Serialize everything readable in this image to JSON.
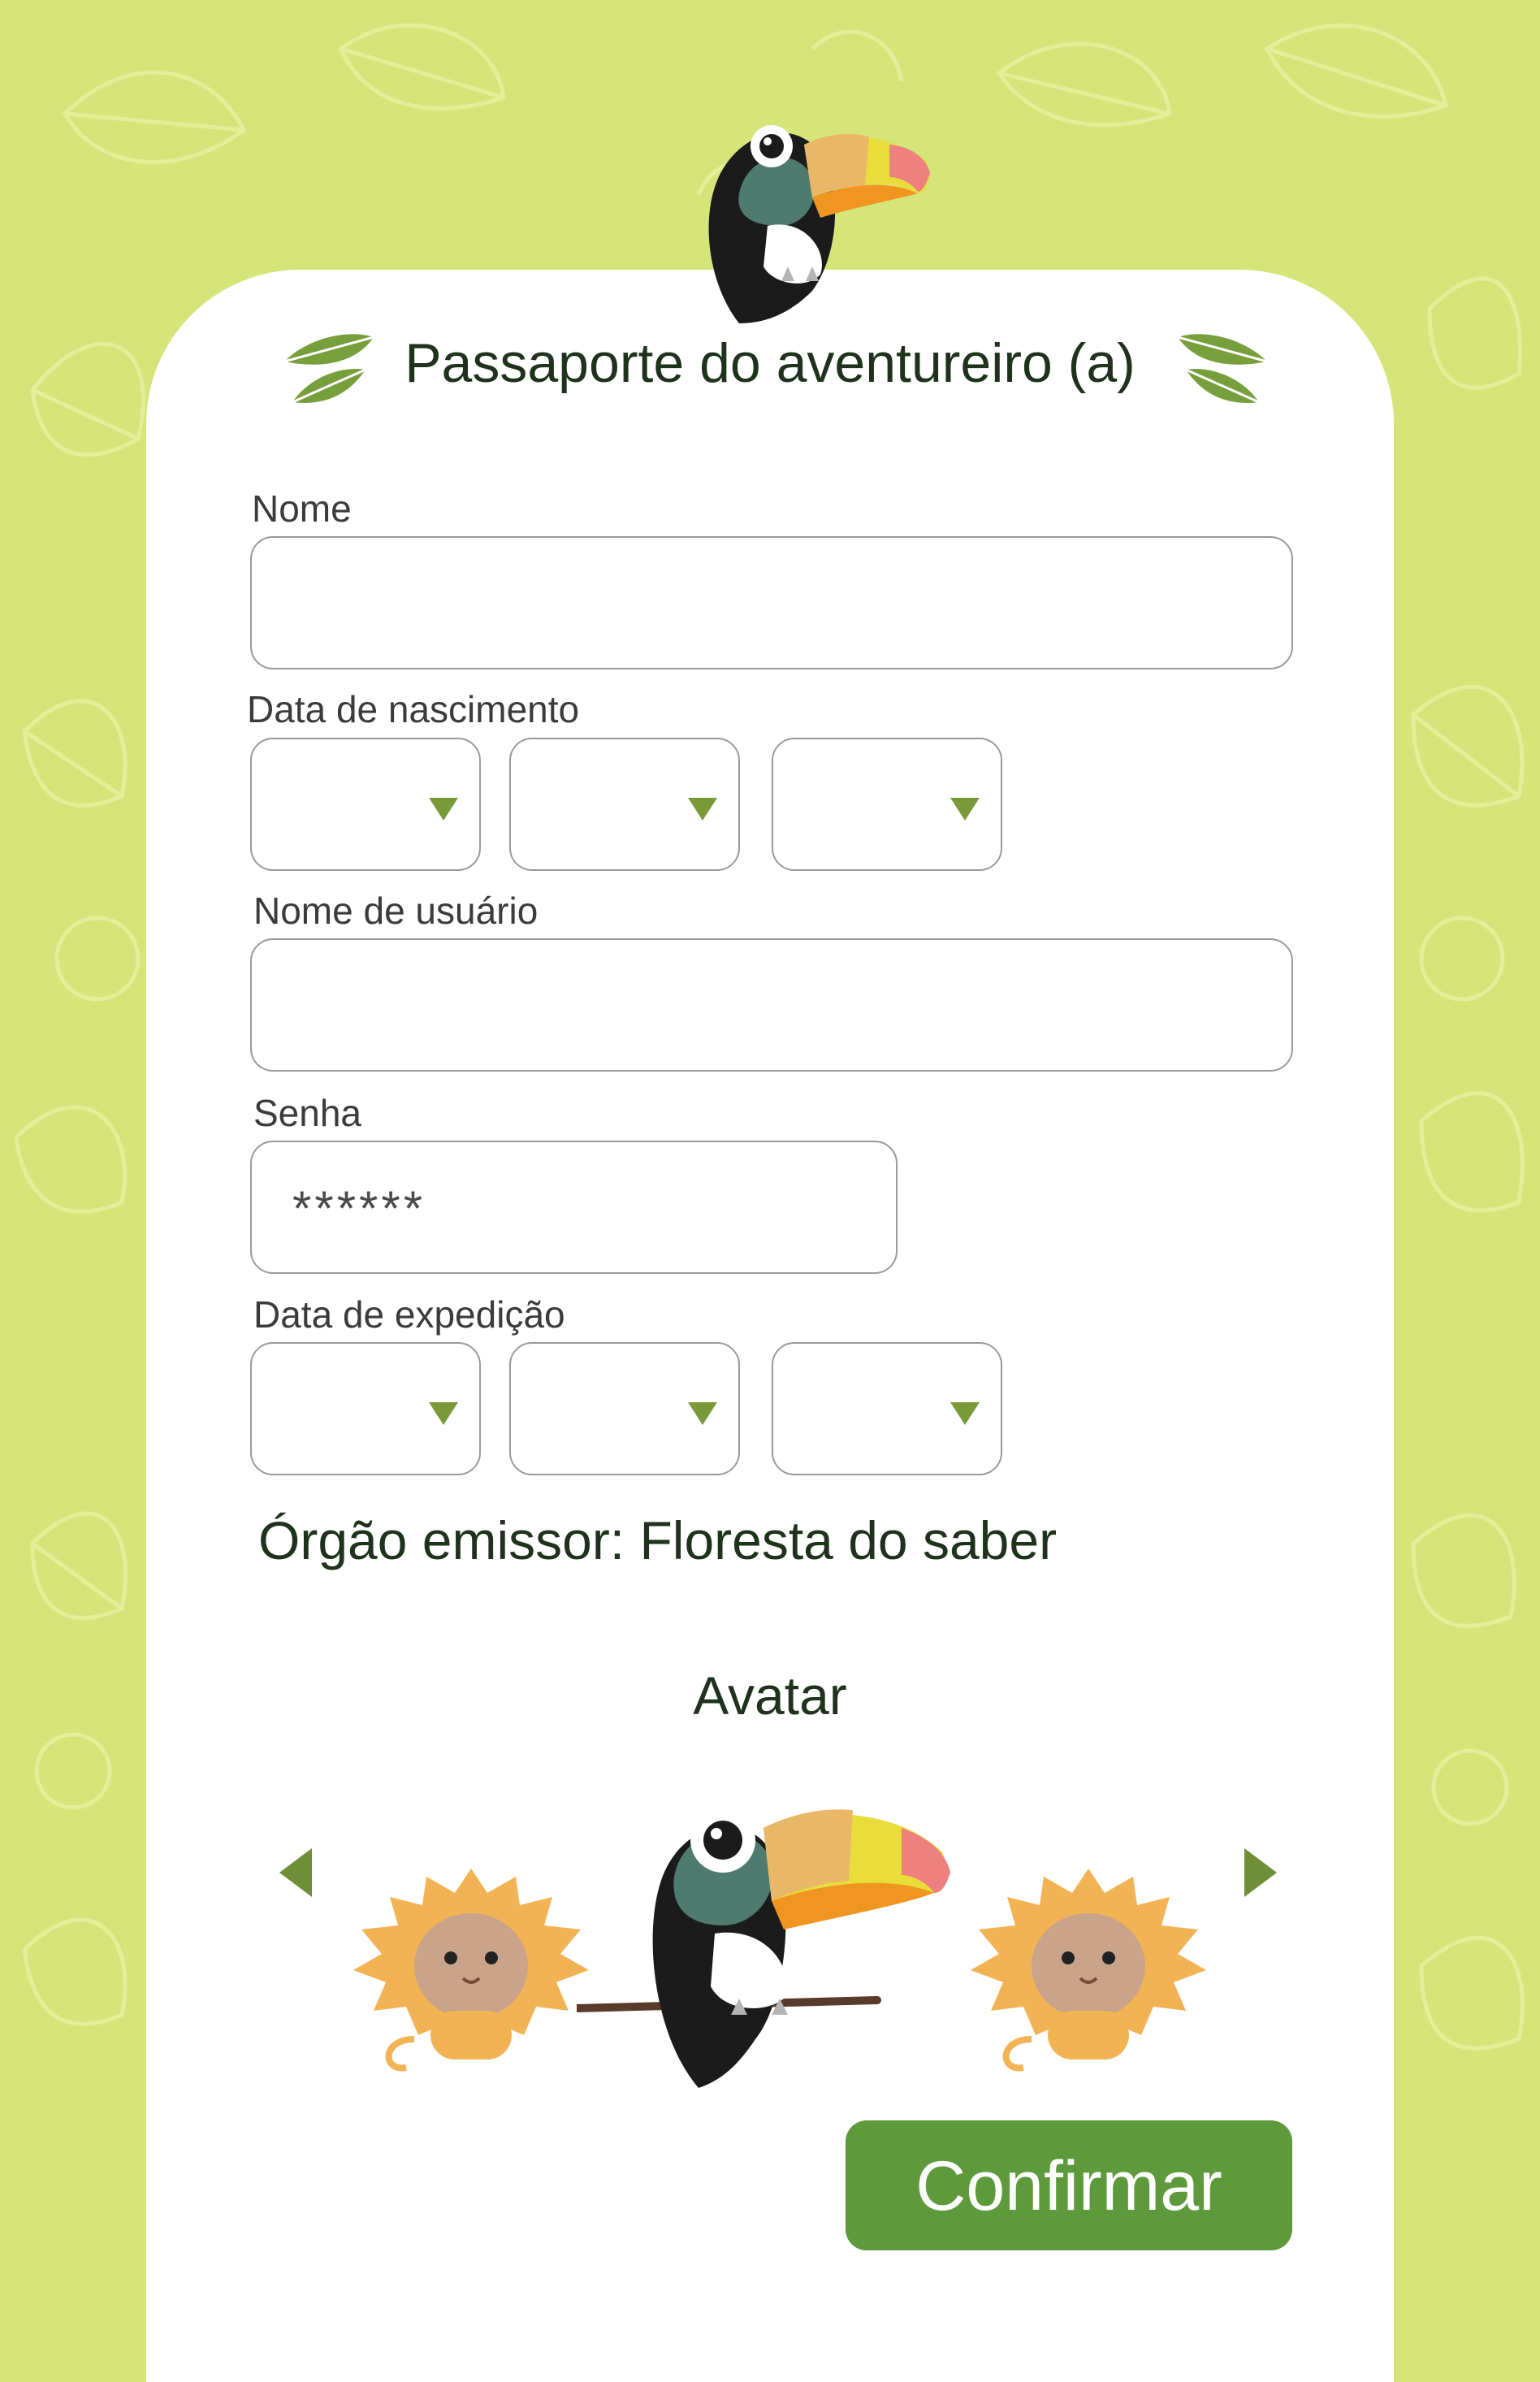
{
  "colors": {
    "background": "#d6e57a",
    "card": "#ffffff",
    "accent_green": "#5e9a3c",
    "leaf_green": "#6e8f38",
    "title_text": "#1e321c"
  },
  "header": {
    "title": "Passaporte do aventureiro (a)",
    "mascot_icon": "toucan-icon",
    "title_decoration_icon": "leaf-icon"
  },
  "form": {
    "name": {
      "label": "Nome",
      "value": ""
    },
    "birth_date": {
      "label": "Data de nascimento",
      "day": "",
      "month": "",
      "year": ""
    },
    "username": {
      "label": "Nome de usuário",
      "value": ""
    },
    "password": {
      "label": "Senha",
      "value": "******"
    },
    "issue_date": {
      "label": "Data de expedição",
      "day": "",
      "month": "",
      "year": ""
    }
  },
  "issuer_text": "Órgão emissor: Floresta do saber",
  "avatar": {
    "title": "Avatar",
    "selected": "toucan-icon",
    "options": [
      "monkey-icon",
      "toucan-icon",
      "monkey-icon"
    ],
    "prev_icon": "triangle-left-icon",
    "next_icon": "triangle-right-icon"
  },
  "confirm_label": "Confirmar"
}
